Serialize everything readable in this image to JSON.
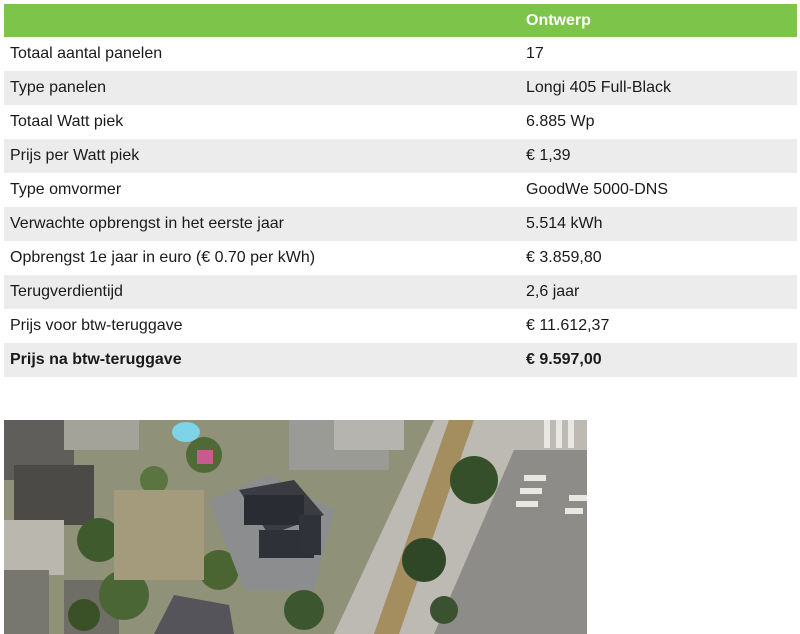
{
  "table": {
    "header": [
      "",
      "Ontwerp"
    ],
    "rows": [
      {
        "label": "Totaal aantal panelen",
        "value": "17"
      },
      {
        "label": "Type panelen",
        "value": "Longi 405 Full-Black"
      },
      {
        "label": "Totaal Watt piek",
        "value": "6.885 Wp"
      },
      {
        "label": "Prijs per Watt piek",
        "value": "€ 1,39"
      },
      {
        "label": "Type omvormer",
        "value": "GoodWe 5000-DNS"
      },
      {
        "label": "Verwachte opbrengst in het eerste jaar",
        "value": "5.514 kWh"
      },
      {
        "label": "Opbrengst 1e jaar in euro (€ 0.70 per kWh)",
        "value": "€ 3.859,80"
      },
      {
        "label": "Terugverdientijd",
        "value": "2,6 jaar"
      },
      {
        "label": "Prijs voor btw-teruggave",
        "value": "€ 11.612,37"
      },
      {
        "label": "Prijs na btw-teruggave",
        "value": "€ 9.597,00"
      }
    ]
  },
  "colors": {
    "header_green": "#7dc44a",
    "row_stripe": "#ececec"
  }
}
